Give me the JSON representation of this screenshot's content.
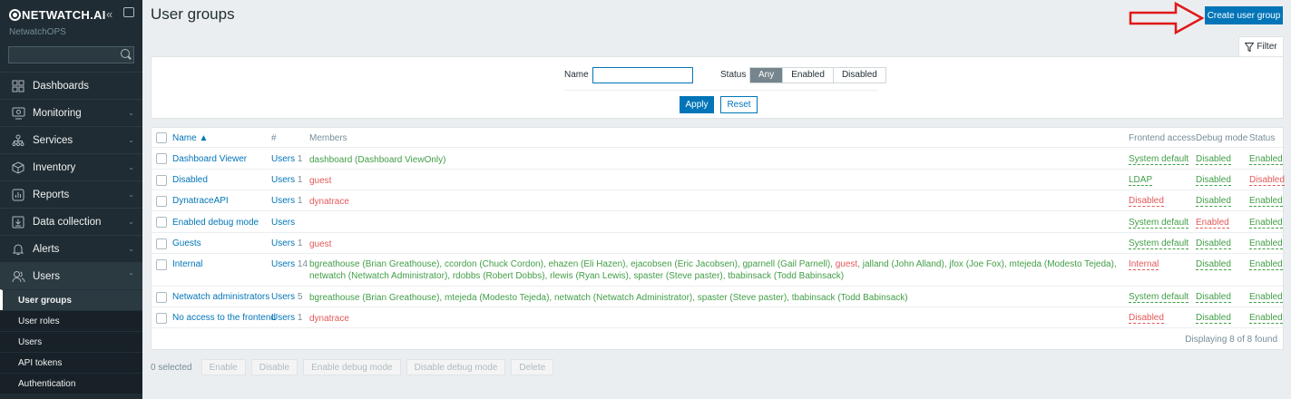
{
  "sidebar": {
    "brand": "NETWATCH.AI",
    "org": "NetwatchOPS",
    "search_placeholder": "",
    "items": [
      {
        "label": "Dashboards",
        "icon": "dashboard-icon"
      },
      {
        "label": "Monitoring",
        "icon": "monitoring-icon"
      },
      {
        "label": "Services",
        "icon": "services-icon"
      },
      {
        "label": "Inventory",
        "icon": "inventory-icon"
      },
      {
        "label": "Reports",
        "icon": "reports-icon"
      },
      {
        "label": "Data collection",
        "icon": "data-collection-icon"
      },
      {
        "label": "Alerts",
        "icon": "alerts-icon"
      },
      {
        "label": "Users",
        "icon": "users-icon"
      }
    ],
    "users_sub": [
      "User groups",
      "User roles",
      "Users",
      "API tokens",
      "Authentication"
    ]
  },
  "header": {
    "title": "User groups",
    "create_label": "Create user group"
  },
  "filter": {
    "tab_label": "Filter",
    "name_label": "Name",
    "name_value": "",
    "status_label": "Status",
    "status_options": [
      "Any",
      "Enabled",
      "Disabled"
    ],
    "apply_label": "Apply",
    "reset_label": "Reset"
  },
  "table": {
    "headers": {
      "name": "Name ▲",
      "count": "#",
      "members": "Members",
      "frontend": "Frontend access",
      "debug": "Debug mode",
      "status": "Status"
    },
    "rows": [
      {
        "name": "Dashboard Viewer",
        "users": "Users",
        "count": "1",
        "members": "dashboard (Dashboard ViewOnly)",
        "frontend": "System default",
        "debug": "Disabled",
        "status": "Enabled"
      },
      {
        "name": "Disabled",
        "users": "Users",
        "count": "1",
        "members": "guest",
        "frontend": "LDAP",
        "debug": "Disabled",
        "status": "Disabled"
      },
      {
        "name": "DynatraceAPI",
        "users": "Users",
        "count": "1",
        "members": "dynatrace",
        "frontend": "Disabled",
        "debug": "Disabled",
        "status": "Enabled"
      },
      {
        "name": "Enabled debug mode",
        "users": "Users",
        "count": "",
        "members": "",
        "frontend": "System default",
        "debug": "Enabled",
        "status": "Enabled"
      },
      {
        "name": "Guests",
        "users": "Users",
        "count": "1",
        "members": "guest",
        "frontend": "System default",
        "debug": "Disabled",
        "status": "Enabled"
      },
      {
        "name": "Internal",
        "users": "Users",
        "count": "14",
        "members_a": "bgreathouse (Brian Greathouse), ccordon (Chuck Cordon), ehazen (Eli Hazen), ejacobsen (Eric Jacobsen), gparnell (Gail Parnell), ",
        "members_guest": "guest",
        "members_b": ", jalland (John Alland), jfox (Joe Fox), mtejeda (Modesto Tejeda), netwatch (Netwatch Administrator), rdobbs (Robert Dobbs), rlewis (Ryan Lewis), spaster (Steve paster), tbabinsack (Todd Babinsack)",
        "frontend": "Internal",
        "debug": "Disabled",
        "status": "Enabled"
      },
      {
        "name": "Netwatch administrators",
        "users": "Users",
        "count": "5",
        "members": "bgreathouse (Brian Greathouse), mtejeda (Modesto Tejeda), netwatch (Netwatch Administrator), spaster (Steve paster), tbabinsack (Todd Babinsack)",
        "frontend": "System default",
        "debug": "Disabled",
        "status": "Enabled"
      },
      {
        "name": "No access to the frontend",
        "users": "Users",
        "count": "1",
        "members": "dynatrace",
        "frontend": "Disabled",
        "debug": "Disabled",
        "status": "Enabled"
      }
    ],
    "displaying": "Displaying 8 of 8 found"
  },
  "bottom": {
    "selected": "0 selected",
    "buttons": [
      "Enable",
      "Disable",
      "Enable debug mode",
      "Disable debug mode",
      "Delete"
    ]
  },
  "colors": {
    "accent": "#0275b8",
    "green": "#429e47",
    "red": "#e45959",
    "sidebar": "#1f2c33"
  }
}
